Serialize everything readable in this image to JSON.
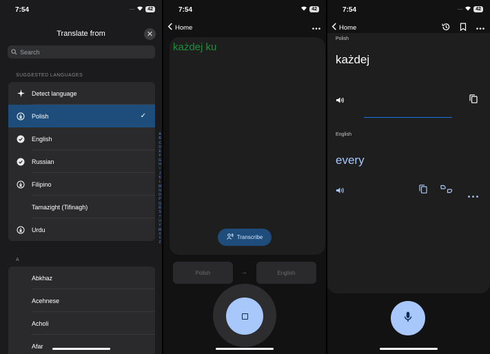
{
  "status": {
    "time": "7:54",
    "battery": "42"
  },
  "panel1": {
    "title": "Translate from",
    "search_placeholder": "Search",
    "suggested_label": "SUGGESTED LANGUAGES",
    "suggested": [
      {
        "label": "Detect language",
        "icon": "sparkle-icon",
        "selected": false
      },
      {
        "label": "Polish",
        "icon": "download-icon",
        "selected": true
      },
      {
        "label": "English",
        "icon": "downloaded-check-icon",
        "selected": false
      },
      {
        "label": "Russian",
        "icon": "downloaded-check-icon",
        "selected": false
      },
      {
        "label": "Filipino",
        "icon": "download-icon",
        "selected": false
      },
      {
        "label": "Tamazight (Tifinagh)",
        "icon": "",
        "selected": false
      },
      {
        "label": "Urdu",
        "icon": "download-icon",
        "selected": false
      }
    ],
    "section_a": "A",
    "all_languages": [
      "Abkhaz",
      "Acehnese",
      "Acholi",
      "Afar"
    ],
    "alphabet": [
      "A",
      "B",
      "C",
      "D",
      "E",
      "F",
      "G",
      "H",
      "I",
      "J",
      "K",
      "L",
      "M",
      "N",
      "O",
      "P",
      "Q",
      "R",
      "S",
      "T",
      "U",
      "V",
      "W",
      "X",
      "Y",
      "Z"
    ]
  },
  "panel2": {
    "back_label": "Home",
    "input_text": "każdej ku",
    "transcribe_label": "Transcribe",
    "source_lang": "Polish",
    "target_lang": "English"
  },
  "panel3": {
    "back_label": "Home",
    "source_lang": "Polish",
    "source_text": "każdej",
    "target_lang": "English",
    "target_text": "every"
  },
  "colors": {
    "accent": "#a8c7fa",
    "selected_row": "#1e4d7b",
    "input_green": "#1e8e3e",
    "divider_blue": "#1a73e8"
  }
}
